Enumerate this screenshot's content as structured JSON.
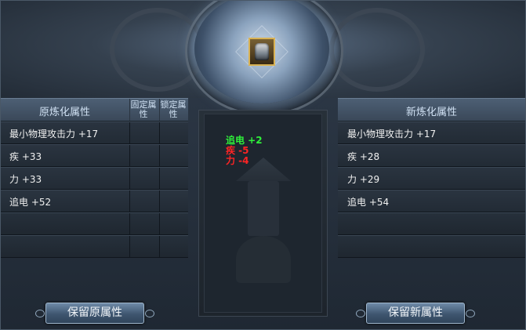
{
  "left_panel": {
    "title": "原炼化属性",
    "col_fixed": "固定属性",
    "col_lock": "锁定属性",
    "rows": [
      "最小物理攻击力 +17",
      "疾 +33",
      "力 +33",
      "追电 +52",
      "",
      ""
    ]
  },
  "right_panel": {
    "title": "新炼化属性",
    "rows": [
      "最小物理攻击力 +17",
      "疾 +28",
      "力 +29",
      "追电 +54",
      "",
      ""
    ]
  },
  "center": {
    "item_icon": "armor-icon",
    "diffs": [
      {
        "text": "追电 +2",
        "color": "#2ff03a"
      },
      {
        "text": "疾 -5",
        "color": "#ff2424"
      },
      {
        "text": "力 -4",
        "color": "#ff2424"
      }
    ]
  },
  "buttons": {
    "keep_original": "保留原属性",
    "keep_new": "保留新属性"
  }
}
